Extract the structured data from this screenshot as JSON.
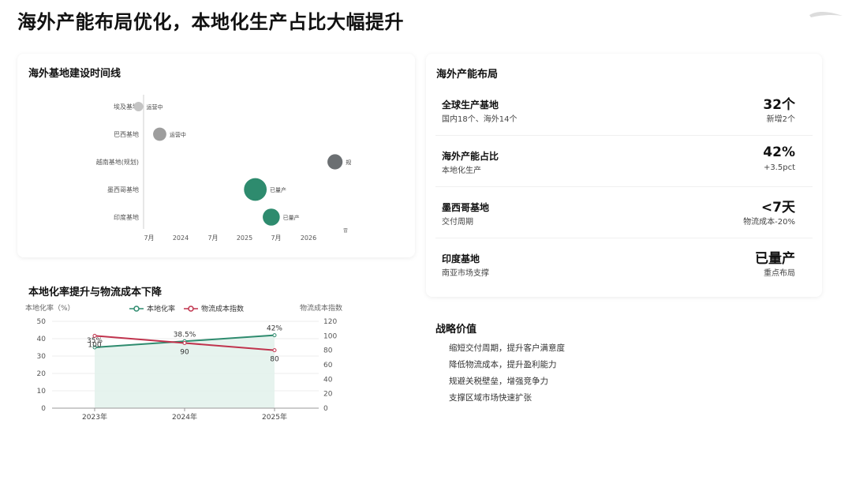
{
  "page": {
    "title": "海外产能布局优化，本地化生产占比大幅提升"
  },
  "timeline": {
    "title": "海外基地建设时间线",
    "rows": [
      {
        "name": "埃及基地",
        "status": "运营中"
      },
      {
        "name": "巴西基地",
        "status": "运营中"
      },
      {
        "name": "越南基地(规划)",
        "status": "规"
      },
      {
        "name": "墨西哥基地",
        "status": "已量产"
      },
      {
        "name": "印度基地",
        "status": "已量产"
      }
    ],
    "x_ticks": [
      "7月",
      "2024",
      "7月",
      "2025",
      "7月",
      "2026",
      "冒"
    ],
    "colors": {
      "operating": "#c4c4c4",
      "operating2": "#9d9d9d",
      "planned": "#6b6f72",
      "producing": "#2e8b6e"
    }
  },
  "layout": {
    "title": "海外产能布局",
    "rows": [
      {
        "label": "全球生产基地",
        "sub": "国内18个、海外14个",
        "value": "32个",
        "note": "新增2个"
      },
      {
        "label": "海外产能占比",
        "sub": "本地化生产",
        "value": "42%",
        "note": "+3.5pct"
      },
      {
        "label": "墨西哥基地",
        "sub": "交付周期",
        "value": "<7天",
        "note": "物流成本-20%"
      },
      {
        "label": "印度基地",
        "sub": "南亚市场支撑",
        "value": "已量产",
        "note": "重点布局"
      }
    ]
  },
  "strategy": {
    "title": "战略价值",
    "items": [
      "缩短交付周期，提升客户满意度",
      "降低物流成本，提升盈利能力",
      "规避关税壁垒，增强竞争力",
      "支撑区域市场快速扩张"
    ]
  },
  "combo": {
    "title": "本地化率提升与物流成本下降"
  },
  "chart_data": [
    {
      "type": "scatter",
      "title": "海外基地建设时间线",
      "categories": [
        "埃及基地",
        "巴西基地",
        "越南基地(规划)",
        "墨西哥基地",
        "印度基地"
      ],
      "x_tick_labels": [
        "7月",
        "2024",
        "7月",
        "2025",
        "7月",
        "2026"
      ],
      "points": [
        {
          "category": "埃及基地",
          "x": "2023-05",
          "status": "运营中",
          "size": 1
        },
        {
          "category": "巴西基地",
          "x": "2023-09",
          "status": "运营中",
          "size": 1.4
        },
        {
          "category": "越南基地(规划)",
          "x": "2026-06",
          "status": "规划",
          "size": 1.6
        },
        {
          "category": "墨西哥基地",
          "x": "2025-03",
          "status": "已量产",
          "size": 2.4
        },
        {
          "category": "印度基地",
          "x": "2025-06",
          "status": "已量产",
          "size": 1.8
        }
      ]
    },
    {
      "type": "line",
      "title": "本地化率提升与物流成本下降",
      "categories": [
        "2023年",
        "2024年",
        "2025年"
      ],
      "ylabel": "本地化率（%）",
      "y2label": "物流成本指数",
      "ylim": [
        0,
        50
      ],
      "y2lim": [
        0,
        120
      ],
      "y_ticks": [
        0,
        10,
        20,
        30,
        40,
        50
      ],
      "y2_ticks": [
        0,
        20,
        40,
        60,
        80,
        100,
        120
      ],
      "series": [
        {
          "name": "本地化率",
          "axis": "left",
          "values": [
            35,
            38.5,
            42
          ],
          "labels": [
            "35%",
            "38.5%",
            "42%"
          ],
          "color": "#2e8b6e",
          "area": true
        },
        {
          "name": "物流成本指数",
          "axis": "right",
          "values": [
            100,
            90,
            80
          ],
          "labels": [
            "100",
            "90",
            "80"
          ],
          "color": "#c0334d"
        }
      ],
      "legend": "top"
    }
  ]
}
